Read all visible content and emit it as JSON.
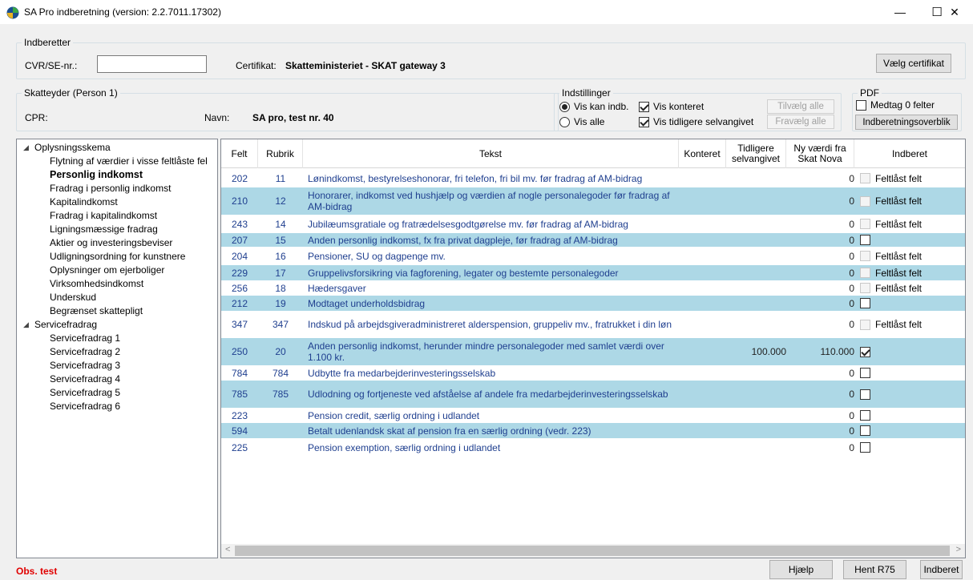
{
  "window": {
    "title": "SA Pro indberetning (version: 2.2.7011.17302)",
    "minimize": "—",
    "maximize": "☐",
    "close": "✕"
  },
  "indberetter": {
    "legend": "Indberetter",
    "cvr_label": "CVR/SE-nr.:",
    "cvr_value": "",
    "cert_label": "Certifikat:",
    "cert_value": "Skatteministeriet - SKAT gateway 3",
    "choose_cert_button": "Vælg certifikat"
  },
  "skatteyder": {
    "legend": "Skatteyder (Person 1)",
    "cpr_label": "CPR:",
    "name_label": "Navn:",
    "name_value": "SA pro, test nr. 40"
  },
  "settings": {
    "legend": "Indstillinger",
    "radio_can_report": "Vis kan indb.",
    "radio_all": "Vis alle",
    "chk_booked": "Vis konteret",
    "chk_previous": "Vis tidligere selvangivet",
    "select_all": "Tilvælg alle",
    "deselect_all": "Fravælg alle"
  },
  "pdf": {
    "legend": "PDF",
    "include_zero": "Medtag 0 felter",
    "overview_button": "Indberetningsoverblik"
  },
  "tree": {
    "root1": "Oplysningsskema",
    "items1": [
      "Flytning af værdier i visse feltlåste fel",
      "Personlig indkomst",
      "Fradrag i personlig indkomst",
      "Kapitalindkomst",
      "Fradrag i kapitalindkomst",
      "Ligningsmæssige fradrag",
      "Aktier og investeringsbeviser",
      "Udligningsordning for kunstnere",
      "Oplysninger om ejerboliger",
      "Virksomhedsindkomst",
      "Underskud",
      "Begrænset skattepligt"
    ],
    "root2": "Servicefradrag",
    "items2": [
      "Servicefradrag 1",
      "Servicefradrag 2",
      "Servicefradrag 3",
      "Servicefradrag 4",
      "Servicefradrag 5",
      "Servicefradrag 6"
    ]
  },
  "grid": {
    "headers": {
      "felt": "Felt",
      "rubrik": "Rubrik",
      "tekst": "Tekst",
      "konteret": "Konteret",
      "tidligere": "Tidligere selvangivet",
      "ny_vaerdi": "Ny værdi fra Skat Nova",
      "indberet": "Indberet"
    },
    "rows": [
      {
        "felt": "202",
        "rubrik": "11",
        "tekst": "Lønindkomst, bestyrelseshonorar, fri telefon, fri bil mv. før fradrag af AM-bidrag",
        "tidligere": "",
        "ny": "0",
        "check": "locked",
        "locked_text": "Feltlåst felt"
      },
      {
        "felt": "210",
        "rubrik": "12",
        "tekst": "Honorarer, indkomst ved hushjælp og værdien af nogle personalegoder før fradrag af AM-bidrag",
        "tidligere": "",
        "ny": "0",
        "check": "locked",
        "locked_text": "Feltlåst felt"
      },
      {
        "felt": "243",
        "rubrik": "14",
        "tekst": "Jubilæumsgratiale og fratrædelsesgodtgørelse mv. før fradrag af AM-bidrag",
        "tidligere": "",
        "ny": "0",
        "check": "locked",
        "locked_text": "Feltlåst felt"
      },
      {
        "felt": "207",
        "rubrik": "15",
        "tekst": "Anden personlig indkomst, fx fra privat dagpleje, før fradrag af AM-bidrag",
        "tidligere": "",
        "ny": "0",
        "check": "off",
        "locked_text": ""
      },
      {
        "felt": "204",
        "rubrik": "16",
        "tekst": "Pensioner, SU og dagpenge mv.",
        "tidligere": "",
        "ny": "0",
        "check": "locked",
        "locked_text": "Feltlåst felt"
      },
      {
        "felt": "229",
        "rubrik": "17",
        "tekst": "Gruppelivsforsikring via fagforening, legater og bestemte personalegoder",
        "tidligere": "",
        "ny": "0",
        "check": "locked",
        "locked_text": "Feltlåst felt"
      },
      {
        "felt": "256",
        "rubrik": "18",
        "tekst": "Hædersgaver",
        "tidligere": "",
        "ny": "0",
        "check": "locked",
        "locked_text": "Feltlåst felt"
      },
      {
        "felt": "212",
        "rubrik": "19",
        "tekst": "Modtaget underholdsbidrag",
        "tidligere": "",
        "ny": "0",
        "check": "off",
        "locked_text": ""
      },
      {
        "felt": "347",
        "rubrik": "347",
        "tekst": "Indskud på arbejdsgiveradministreret alderspension, gruppeliv mv., fratrukket i din løn",
        "tidligere": "",
        "ny": "0",
        "check": "locked",
        "locked_text": "Feltlåst felt"
      },
      {
        "felt": "250",
        "rubrik": "20",
        "tekst": "Anden personlig indkomst, herunder mindre personalegoder med samlet værdi over 1.100 kr.",
        "tidligere": "100.000",
        "ny": "110.000",
        "check": "on",
        "locked_text": ""
      },
      {
        "felt": "784",
        "rubrik": "784",
        "tekst": "Udbytte fra medarbejderinvesteringsselskab",
        "tidligere": "",
        "ny": "0",
        "check": "off",
        "locked_text": ""
      },
      {
        "felt": "785",
        "rubrik": "785",
        "tekst": "Udlodning og fortjeneste ved afståelse af andele fra medarbejderinvesteringsselskab",
        "tidligere": "",
        "ny": "0",
        "check": "off",
        "locked_text": ""
      },
      {
        "felt": "223",
        "rubrik": "",
        "tekst": "Pension credit, særlig ordning i udlandet",
        "tidligere": "",
        "ny": "0",
        "check": "off",
        "locked_text": ""
      },
      {
        "felt": "594",
        "rubrik": "",
        "tekst": "Betalt udenlandsk skat af pension fra en særlig ordning (vedr. 223)",
        "tidligere": "",
        "ny": "0",
        "check": "off",
        "locked_text": ""
      },
      {
        "felt": "225",
        "rubrik": "",
        "tekst": "Pension exemption, særlig ordning i udlandet",
        "tidligere": "",
        "ny": "0",
        "check": "off",
        "locked_text": ""
      }
    ]
  },
  "footer": {
    "status": "Obs. test",
    "help_button": "Hjælp",
    "fetch_button": "Hent R75",
    "submit_button": "Indberet"
  },
  "colors": {
    "alt_row": "#add8e6",
    "row_text": "#1f3f8f",
    "status_text": "#e00000"
  }
}
